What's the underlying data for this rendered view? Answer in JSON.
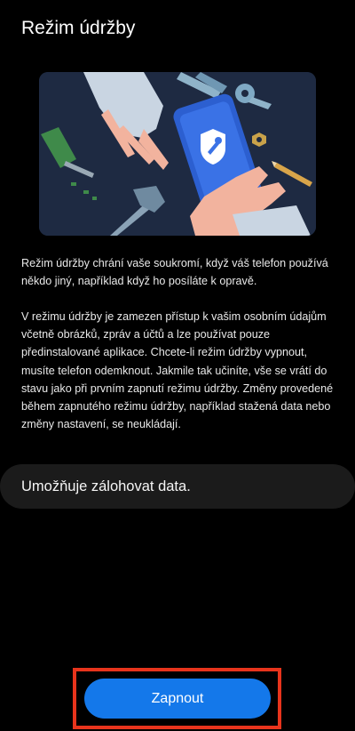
{
  "page": {
    "title": "Režim údržby"
  },
  "illustration": {
    "icon": "shield-wrench-icon"
  },
  "description": {
    "paragraph1": "Režim údržby chrání vaše soukromí, když váš telefon používá někdo jiný, například když ho posíláte k opravě.",
    "paragraph2": "V režimu údržby je zamezen přístup k vašim osobním údajům včetně obrázků, zpráv a účtů a lze používat pouze předinstalované aplikace. Chcete-li režim údržby vypnout, musíte telefon odemknout. Jakmile tak učiníte, vše se vrátí do stavu jako při prvním zapnutí režimu údržby. Změny provedené během zapnutého režimu údržby, například stažená data nebo změny nastavení, se neukládají."
  },
  "feature": {
    "label": "Umožňuje zálohovat data."
  },
  "actions": {
    "primary_label": "Zapnout"
  },
  "colors": {
    "background": "#000000",
    "accent": "#1478ea",
    "highlight": "#e8341c",
    "card": "#1b1b1b"
  }
}
